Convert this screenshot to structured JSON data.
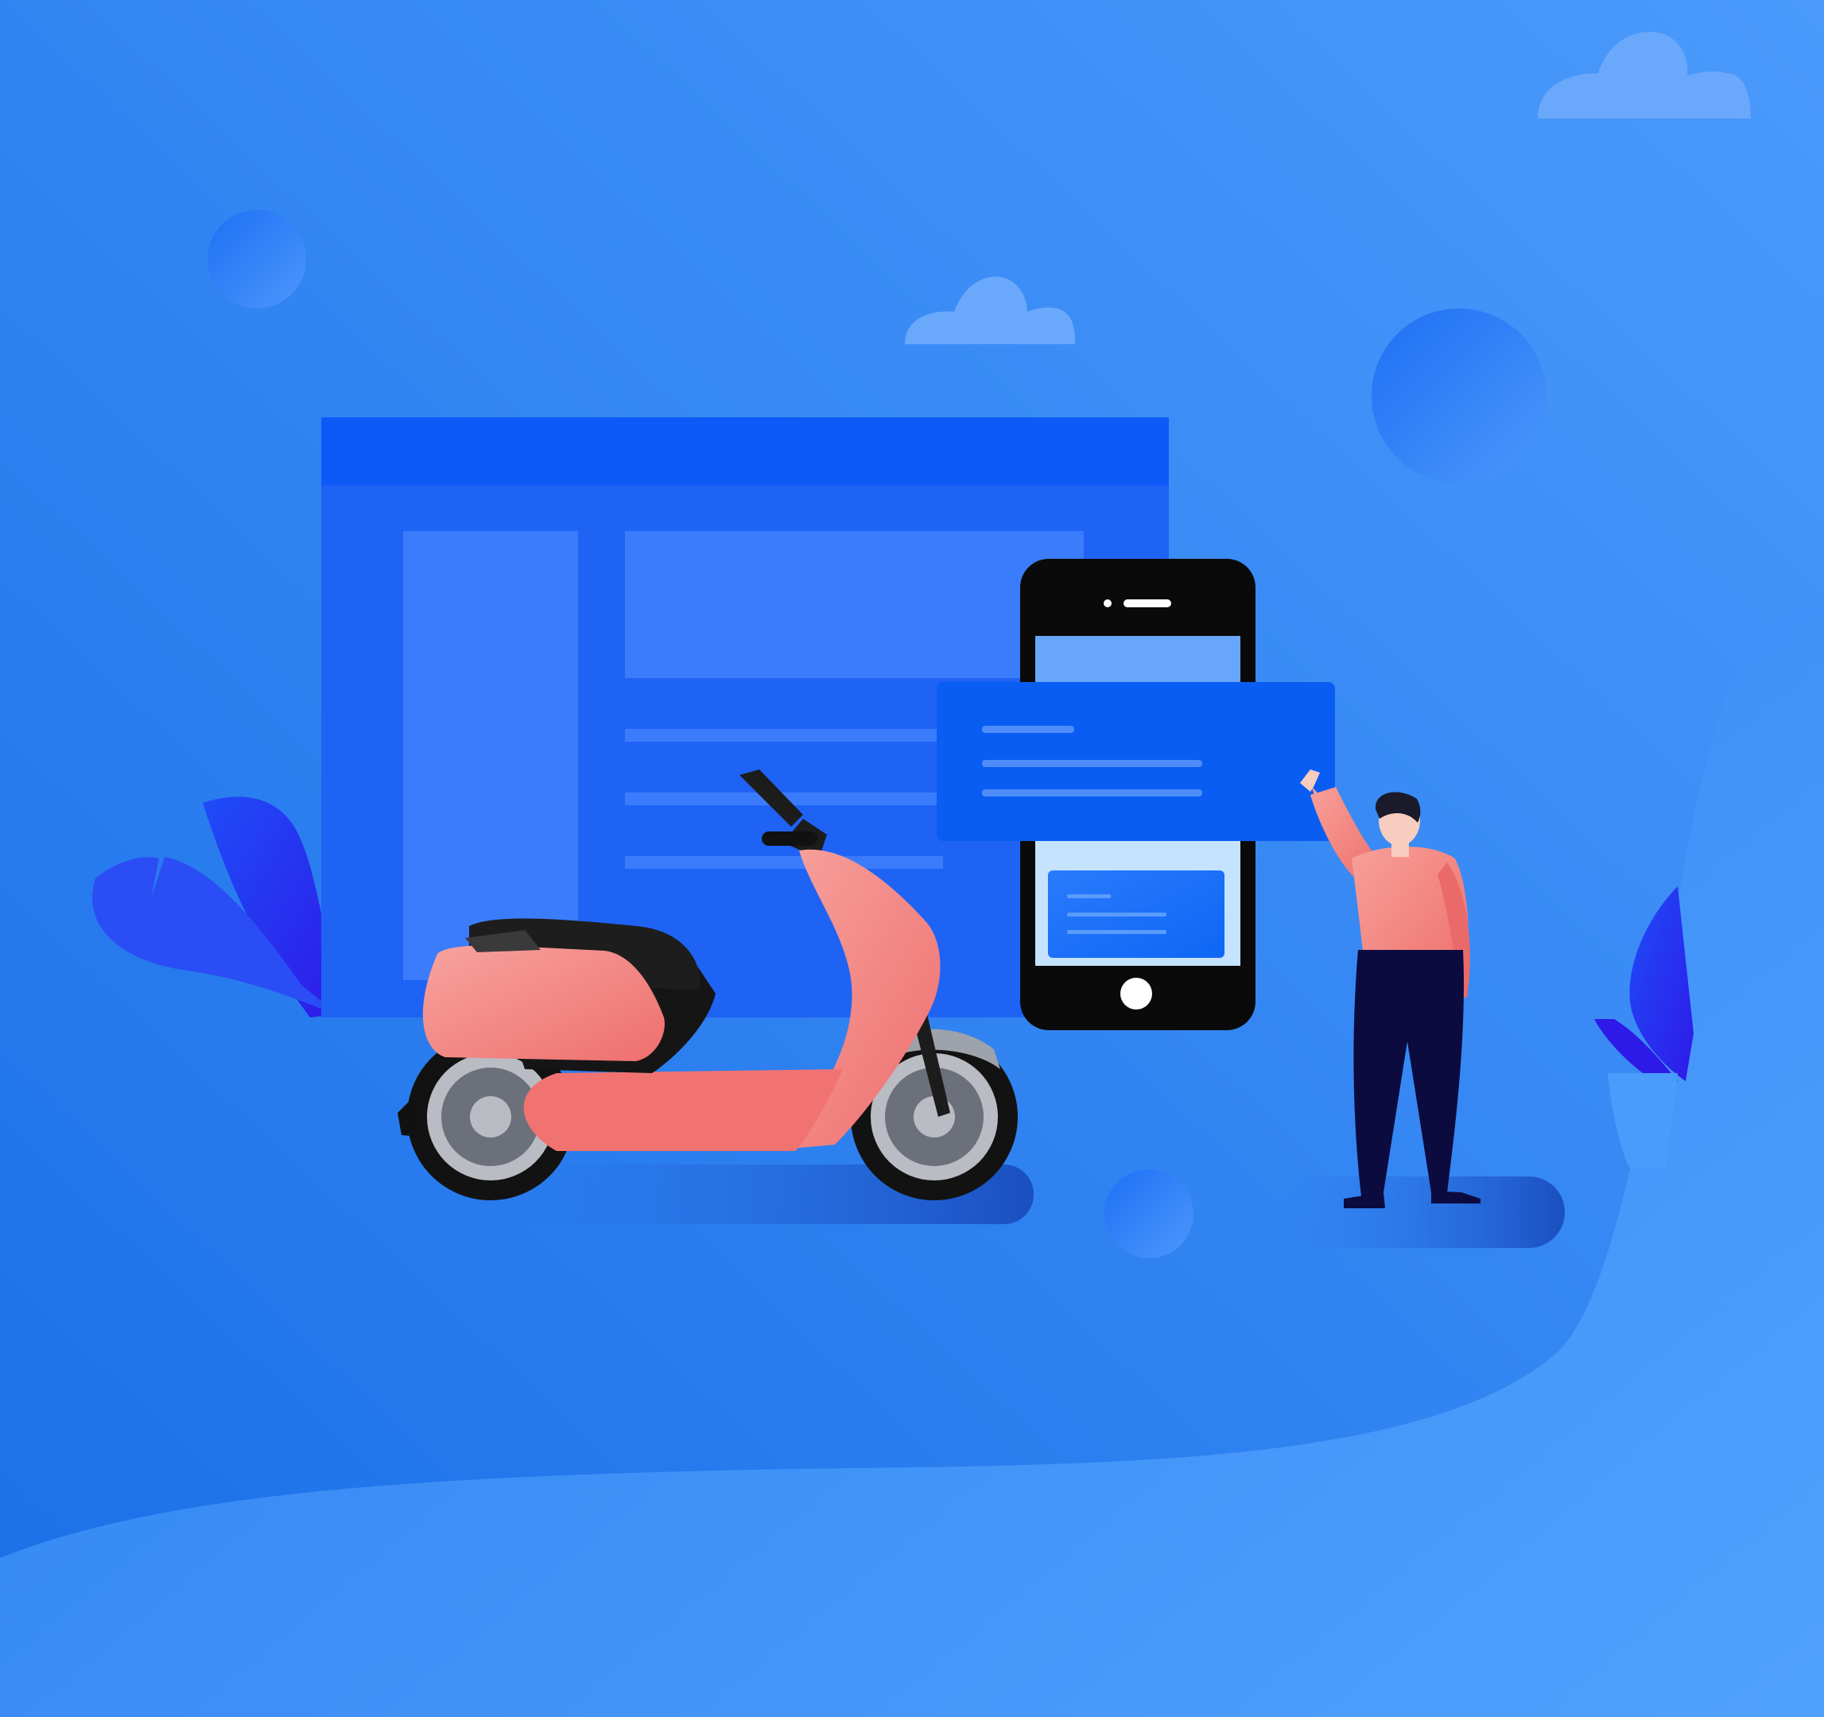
{
  "scene": {
    "kind": "flat vector illustration",
    "subjects": [
      "electric-scooter",
      "smartphone",
      "browser-window",
      "person-pointing"
    ]
  },
  "colors": {
    "background_light": "#4b9afc",
    "background_dark": "#1a6fe8",
    "hill": "#55a5ff",
    "window": "#1f63f5",
    "window_header": "#0f5af7",
    "window_panel": "#3b7cfd",
    "phone_body": "#0a0a0a",
    "phone_screen_top": "#67a6fb",
    "phone_screen_bottom": "#c5e2ff",
    "popup_card": "#0a5df2",
    "popup_line": "#4e8df9",
    "scooter_body": "#f27a7a",
    "scooter_body_light": "#f7a09d",
    "scooter_seat": "#151515",
    "wheel_rim": "#b9bcc3",
    "person_shirt": "#f07c78",
    "person_pants": "#0b0b3f",
    "person_hair": "#1a1a2a",
    "skin": "#f7cdbf",
    "plant": "#2b1df0",
    "cloud": "#6aa8fb",
    "bubble": "#2f7ef6"
  },
  "icons": {
    "phone_camera": "dot-icon",
    "phone_speaker": "speaker-slot-icon",
    "phone_home": "home-button-icon"
  }
}
